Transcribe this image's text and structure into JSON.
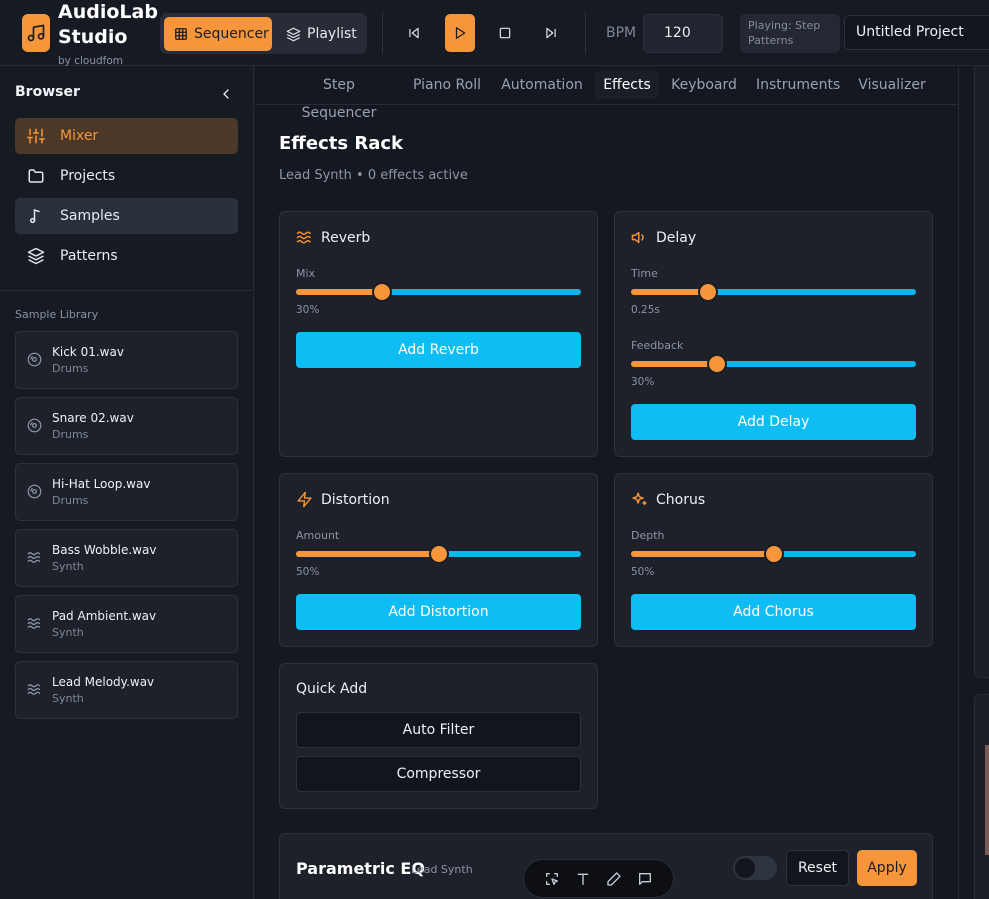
{
  "header": {
    "app_title": "AudioLab Studio",
    "app_subtitle": "by cloudfom",
    "logo_icon": "music-note-icon",
    "modes": [
      {
        "label": "Sequencer",
        "icon": "grid-icon",
        "active": true
      },
      {
        "label": "Playlist",
        "icon": "layers-icon",
        "active": false
      }
    ],
    "transport": [
      "skip-back-icon",
      "play-icon",
      "stop-icon",
      "skip-forward-icon"
    ],
    "bpm_label": "BPM",
    "bpm_value": "120",
    "playing_status": "Playing: Step Patterns",
    "project_name": "Untitled Project"
  },
  "sidebar": {
    "title": "Browser",
    "nav": [
      {
        "label": "Mixer",
        "icon": "sliders-icon",
        "state": "active"
      },
      {
        "label": "Projects",
        "icon": "folder-icon",
        "state": "normal"
      },
      {
        "label": "Samples",
        "icon": "music-note-icon",
        "state": "hover"
      },
      {
        "label": "Patterns",
        "icon": "layers-icon",
        "state": "normal"
      }
    ],
    "library_title": "Sample Library",
    "samples": [
      {
        "name": "Kick 01.wav",
        "category": "Drums",
        "icon": "disc-icon"
      },
      {
        "name": "Snare 02.wav",
        "category": "Drums",
        "icon": "disc-icon"
      },
      {
        "name": "Hi-Hat Loop.wav",
        "category": "Drums",
        "icon": "disc-icon"
      },
      {
        "name": "Bass Wobble.wav",
        "category": "Synth",
        "icon": "waves-icon"
      },
      {
        "name": "Pad Ambient.wav",
        "category": "Synth",
        "icon": "waves-icon"
      },
      {
        "name": "Lead Melody.wav",
        "category": "Synth",
        "icon": "waves-icon"
      }
    ]
  },
  "tabs": [
    "Step Sequencer",
    "Piano Roll",
    "Automation",
    "Effects",
    "Keyboard",
    "Instruments",
    "Visualizer"
  ],
  "active_tab": "Effects",
  "effects": {
    "title": "Effects Rack",
    "subtitle": "Lead Synth • 0 effects active",
    "reverb": {
      "title": "Reverb",
      "icon": "waves-icon",
      "mix_label": "Mix",
      "mix_value": "30%",
      "mix_fraction": 0.3,
      "button": "Add Reverb"
    },
    "delay": {
      "title": "Delay",
      "icon": "speaker-icon",
      "time_label": "Time",
      "time_value": "0.25s",
      "time_fraction": 0.27,
      "feedback_label": "Feedback",
      "feedback_value": "30%",
      "feedback_fraction": 0.3,
      "button": "Add Delay"
    },
    "distortion": {
      "title": "Distortion",
      "icon": "zap-icon",
      "amount_label": "Amount",
      "amount_value": "50%",
      "amount_fraction": 0.5,
      "button": "Add Distortion"
    },
    "chorus": {
      "title": "Chorus",
      "icon": "sparkles-icon",
      "depth_label": "Depth",
      "depth_value": "50%",
      "depth_fraction": 0.5,
      "button": "Add Chorus"
    },
    "quick_add": {
      "title": "Quick Add",
      "buttons": [
        "Auto Filter",
        "Compressor"
      ]
    }
  },
  "eq": {
    "title": "Parametric EQ",
    "subtitle": "Lead Synth",
    "enabled": false,
    "reset": "Reset",
    "apply": "Apply"
  },
  "floating_toolbar": [
    "select-icon",
    "text-icon",
    "pen-icon",
    "comment-icon"
  ],
  "colors": {
    "accent": "#f7953a",
    "primary_button": "#0ebdf4",
    "background": "#141820",
    "card": "#1d2129"
  }
}
